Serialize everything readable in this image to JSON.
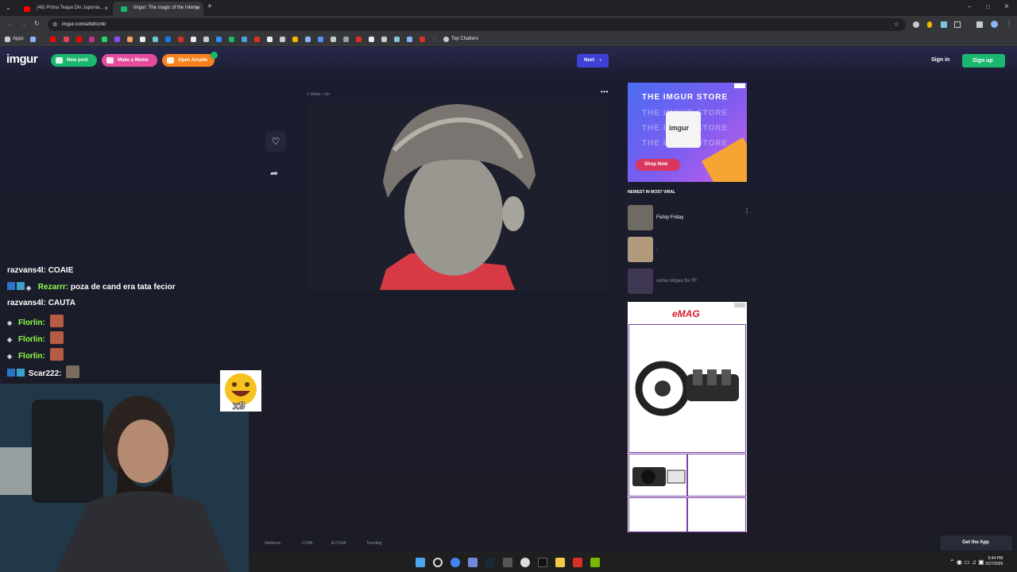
{
  "browser": {
    "tabs": [
      {
        "label": "(48) Prima Teapa Din Japonia...",
        "favicon_color": "#ff0000",
        "active": false
      },
      {
        "label": "Imgur: The magic of the Interne",
        "favicon_color": "#1bb76e",
        "active": true
      }
    ],
    "new_tab": "+",
    "close_glyph": "×",
    "url": "imgur.com/a/bdnznki",
    "apps_label": "Apps",
    "bookmark_folder": "Top Chatters",
    "window_controls": [
      "–",
      "□",
      "×"
    ]
  },
  "imgur": {
    "logo": "imgur",
    "new_post": "New post",
    "make_meme": "Make a Meme",
    "open_arcade": "Open Arcade",
    "next": "Next",
    "next_glyph": "›",
    "sign_in": "Sign in",
    "sign_up": "Sign up",
    "post_meta": "1 Views • 1m",
    "more_glyph": "•••",
    "store_ad": {
      "lines": [
        "THE IMGUR STORE",
        "THE IMGUR STORE",
        "THE IMGUR STORE",
        "THE IMGUR STORE"
      ],
      "mug_text": "imgur",
      "cta": "Shop Now"
    },
    "viral_header": "NEWEST IN MOST VIRAL",
    "viral_items": [
      {
        "title": "Fiship Friday"
      },
      {
        "title": "."
      },
      {
        "title": "some stripes for FF"
      }
    ],
    "emag_logo": "eMAG",
    "footer_links": [
      "Wellness",
      "CCPA",
      "EU DSA",
      "Trending"
    ],
    "get_app": "Get the App"
  },
  "chat": [
    {
      "user": "razvans4l:",
      "msg": "COAIE",
      "user_color": "#ffffff",
      "badges": 0
    },
    {
      "user": "Rezarrr:",
      "msg": "poza de cand era tata fecior",
      "user_color": "#8bff4a",
      "badges": 2
    },
    {
      "user": "razvans4l:",
      "msg": "CAUTA",
      "user_color": "#ffffff",
      "badges": 0
    },
    {
      "user": "Florlin:",
      "msg": "",
      "user_color": "#8bff4a",
      "badges": 0
    },
    {
      "user": "Florlin:",
      "msg": "",
      "user_color": "#8bff4a",
      "badges": 0
    },
    {
      "user": "Florlin:",
      "msg": "",
      "user_color": "#8bff4a",
      "badges": 0
    },
    {
      "user": "Scar222:",
      "msg": "",
      "user_color": "#ffffff",
      "badges": 2
    }
  ],
  "emote_counter": "x9",
  "clock": {
    "time": "5:44 PM",
    "date": "2/27/2026"
  }
}
